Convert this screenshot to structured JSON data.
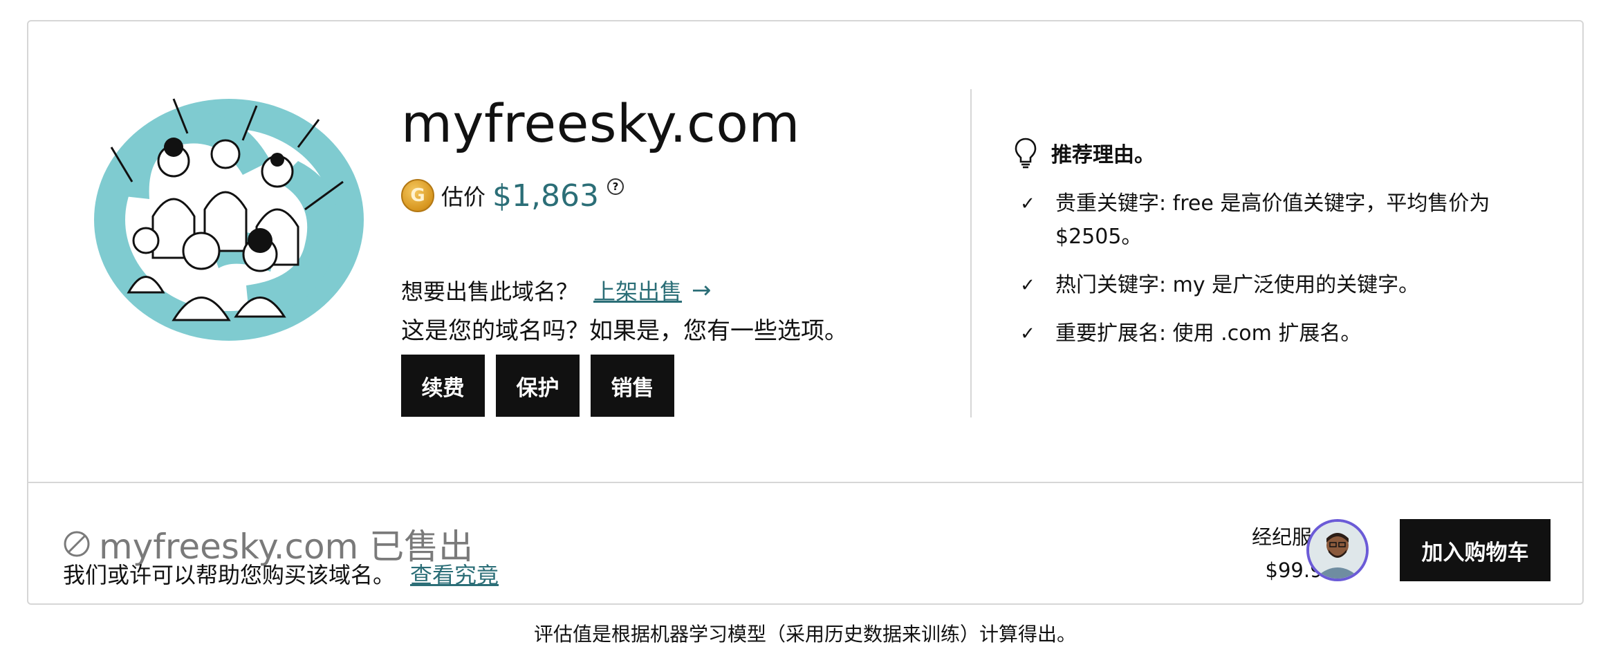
{
  "domain": {
    "name": "myfreesky.com",
    "estimate_label": "估价",
    "estimate_value": "$1,863",
    "help_glyph": "?"
  },
  "sell": {
    "question": "想要出售此域名？",
    "link_label": "上架出售",
    "arrow": "→"
  },
  "ownership": {
    "text": "这是您的域名吗？如果是，您有一些选项。"
  },
  "actions": {
    "renew": "续费",
    "protect": "保护",
    "sell": "销售"
  },
  "reasons": {
    "title": "推荐理由。",
    "items": [
      {
        "text": "贵重关键字: free 是高价值关键字，平均售价为 $2505。"
      },
      {
        "text": "热门关键字: my 是广泛使用的关键字。"
      },
      {
        "text": "重要扩展名: 使用 .com 扩展名。"
      }
    ],
    "check_glyph": "✓"
  },
  "sold": {
    "title": "myfreesky.com 已售出",
    "help_text": "我们或许可以帮助您购买该域名。",
    "link_label": "查看究竟"
  },
  "broker": {
    "label": "经纪服务费",
    "price": "$99.99",
    "help_glyph": "?"
  },
  "cart": {
    "label": "加入购物车"
  },
  "footnote": "评估值是根据机器学习模型（采用历史数据来训练）计算得出。",
  "icons": {
    "coin": "coin-icon",
    "bulb": "lightbulb-icon",
    "ban": "ban-icon",
    "check": "check-icon"
  },
  "colors": {
    "accent": "#2b6e77",
    "teal_illustration": "#7fcbd0",
    "button": "#111111",
    "avatar_ring": "#6b5bd7",
    "muted": "#7a7a7a"
  }
}
